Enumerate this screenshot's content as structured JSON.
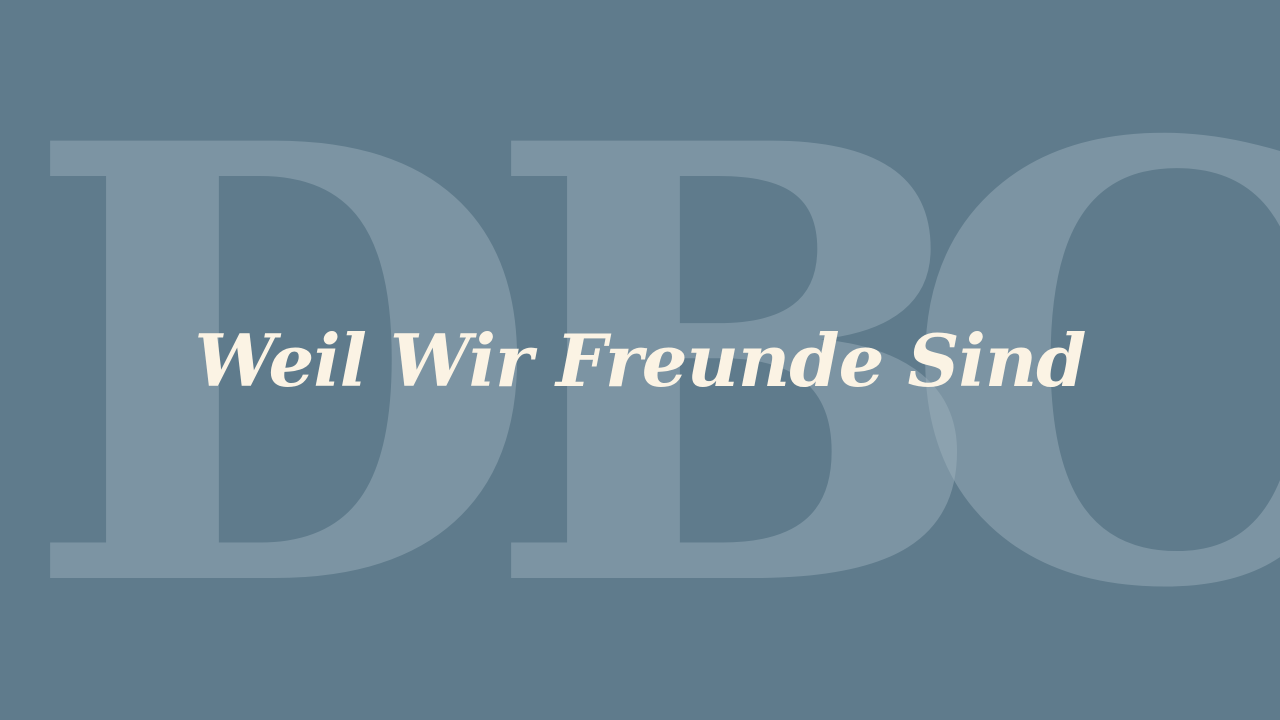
{
  "background_color": "#5f7b8c",
  "watermark": {
    "letters": [
      "D",
      "B",
      "C"
    ],
    "color": "rgba(160,180,190,0.45)"
  },
  "title": {
    "text": "Weil Wir Freunde Sind",
    "color": "#fbf3e4"
  }
}
